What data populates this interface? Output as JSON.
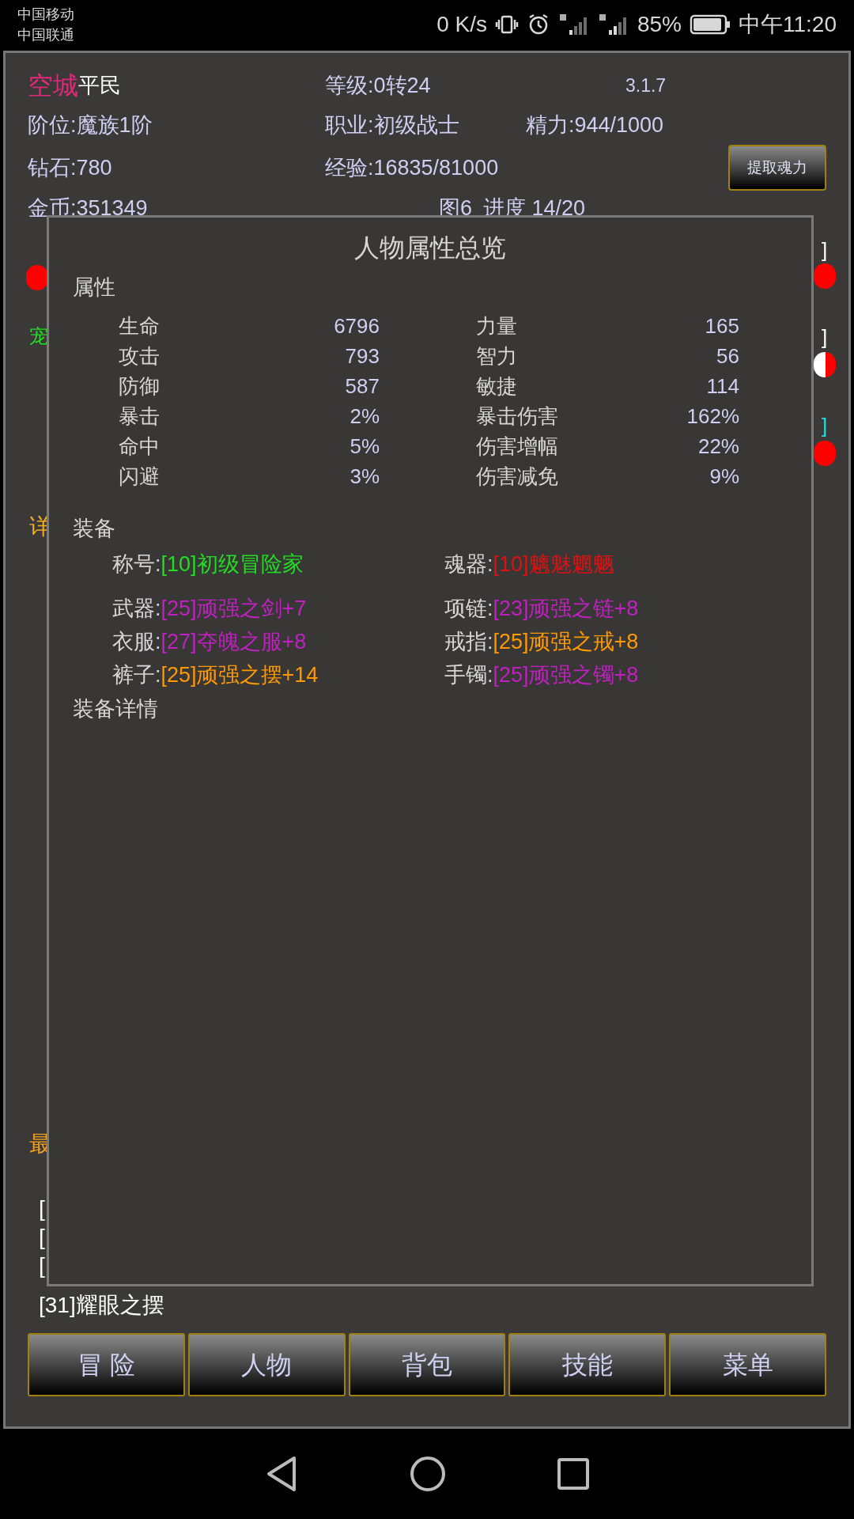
{
  "status_bar": {
    "carriers": [
      "中国移动",
      "中国联通"
    ],
    "net_speed": "0 K/s",
    "battery": "85%",
    "time": "中午11:20"
  },
  "header": {
    "name": "空城",
    "rank": "平民",
    "level": "等级:0转24",
    "version": "3.1.7",
    "tier": "阶位:魔族1阶",
    "class": "职业:初级战士",
    "energy": "精力:944/1000",
    "diamonds": "钻石:780",
    "exp": "经验:16835/81000",
    "gold": "金币:351349",
    "map": "图6",
    "progress": "进度 14/20",
    "extract_button": "提取魂力"
  },
  "background_fragments": [
    {
      "text": "宠",
      "color": "#22dd22"
    },
    {
      "text": "详",
      "color": "#f0b020"
    },
    {
      "text": "最",
      "color": "#f0a020"
    },
    {
      "text": "[",
      "color": "#ffffff"
    },
    {
      "text": "[",
      "color": "#ffffff"
    },
    {
      "text": "[",
      "color": "#ffffff"
    },
    {
      "text": "[31]耀眼之摆",
      "color": "#ffffff"
    },
    {
      "text": "]",
      "color": "#ffffff"
    },
    {
      "text": "]",
      "color": "#ffffff"
    },
    {
      "text": "]",
      "color": "#22dddd"
    }
  ],
  "markers": [
    {
      "kind": "full"
    },
    {
      "kind": "full"
    },
    {
      "kind": "half"
    },
    {
      "kind": "full"
    }
  ],
  "dialog": {
    "title": "人物属性总览",
    "attributes_heading": "属性",
    "attributes": [
      {
        "label": "生命",
        "value": "6796",
        "label_2": "力量",
        "value_2": "165"
      },
      {
        "label": "攻击",
        "value": "793",
        "label_2": "智力",
        "value_2": "56"
      },
      {
        "label": "防御",
        "value": "587",
        "label_2": "敏捷",
        "value_2": "114"
      },
      {
        "label": "暴击",
        "value": "2%",
        "label_2": "暴击伤害",
        "value_2": "162%"
      },
      {
        "label": "命中",
        "value": "5%",
        "label_2": "伤害增幅",
        "value_2": "22%"
      },
      {
        "label": "闪避",
        "value": "3%",
        "label_2": "伤害减免",
        "value_2": "9%"
      }
    ],
    "equipment_heading": "装备",
    "equipment": [
      {
        "slot": "称号:",
        "item": "[10]初级冒险家",
        "color": "#22dd22"
      },
      {
        "slot": "魂器:",
        "item": "[10]魑魅魍魉",
        "color": "#dd1111"
      },
      {
        "slot": "武器:",
        "item": "[25]顽强之剑+7",
        "color": "#c020c0"
      },
      {
        "slot": "项链:",
        "item": "[23]顽强之链+8",
        "color": "#c020c0"
      },
      {
        "slot": "衣服:",
        "item": "[27]夺魄之服+8",
        "color": "#c020c0"
      },
      {
        "slot": "戒指:",
        "item": "[25]顽强之戒+8",
        "color": "#ff9900"
      },
      {
        "slot": "裤子:",
        "item": "[25]顽强之摆+14",
        "color": "#ff9900"
      },
      {
        "slot": "手镯:",
        "item": "[25]顽强之镯+8",
        "color": "#c020c0"
      }
    ],
    "details_link": "装备详情"
  },
  "nav": [
    {
      "label": "冒 险"
    },
    {
      "label": "人物"
    },
    {
      "label": "背包"
    },
    {
      "label": "技能"
    },
    {
      "label": "菜单"
    }
  ]
}
